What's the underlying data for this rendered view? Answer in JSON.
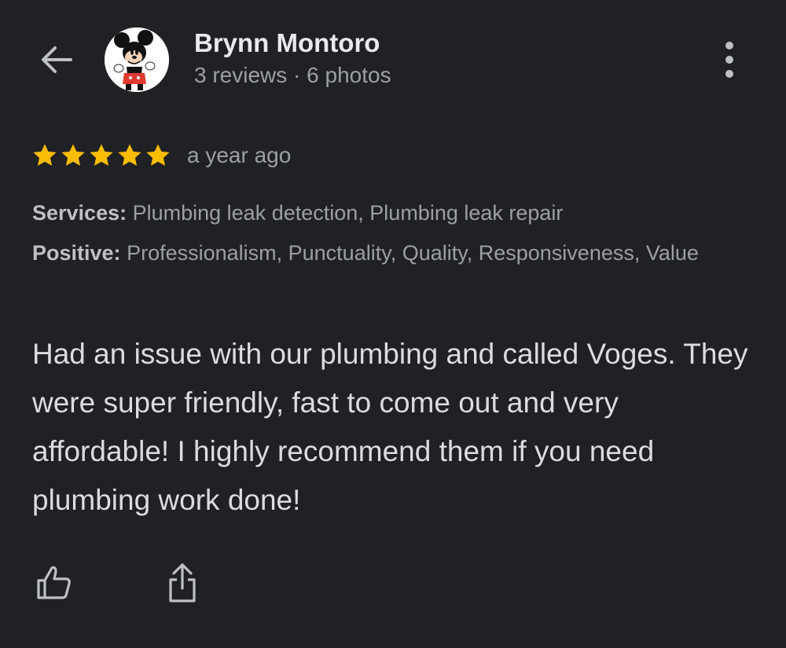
{
  "header": {
    "back_icon": "arrow-left-icon",
    "reviewer_name": "Brynn Montoro",
    "reviewer_meta": "3 reviews · 6 photos",
    "avatar": "mickey-mouse-avatar",
    "more_icon": "more-vertical-icon"
  },
  "review": {
    "rating": 5,
    "rating_max": 5,
    "star_color": "#fbbc04",
    "time_ago": "a year ago",
    "services_label": "Services:",
    "services_value": "Plumbing leak detection, Plumbing leak repair",
    "positive_label": "Positive:",
    "positive_value": "Professionalism, Punctuality, Quality, Responsiveness, Value",
    "text": "Had an issue with our plumbing and called Voges. They were super friendly, fast to come out and very affordable! I highly recommend them if you need plumbing work done!"
  },
  "actions": {
    "like_icon": "thumbs-up-icon",
    "share_icon": "share-icon"
  },
  "colors": {
    "background": "#202124",
    "primary_text": "#e8eaed",
    "secondary_text": "#9aa0a6",
    "icon": "#bdc1c6"
  }
}
